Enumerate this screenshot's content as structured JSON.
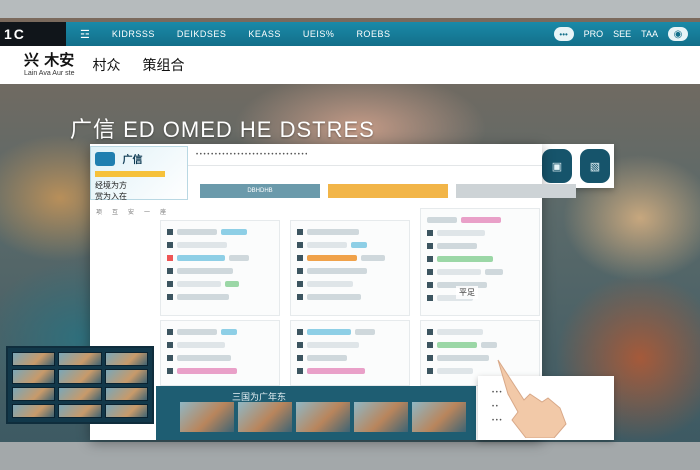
{
  "topbar": {
    "brand": "1C",
    "menu_icon": "☲",
    "links": [
      "KIDRSSS",
      "DEIKDSES",
      "KEASS",
      "UEIS%",
      "ROEBS"
    ],
    "right_links": [
      "PRO",
      "SEE",
      "TAA"
    ],
    "globe_icon": "globe-icon"
  },
  "header": {
    "logo_main": "兴 木安",
    "logo_sub": "Lain Ava Aur ste",
    "tag1": "村众",
    "tag2": "策组合"
  },
  "hero": {
    "title": "广信 ED OMED HE DSTRES"
  },
  "window": {
    "info_card": {
      "title": "广信",
      "lines": [
        "经境为方",
        "赏为入在"
      ]
    },
    "tabs": [
      "DBHDHB",
      "",
      ""
    ],
    "subnav": [
      "项",
      "互",
      "安",
      "一",
      "座"
    ],
    "float_note": "平足"
  },
  "bottom_strip": {
    "title": "三国为广年东"
  },
  "right_icons": [
    "grid-icon",
    "bag-icon",
    "backpack-icon"
  ],
  "colors": {
    "nav": "#1a8aa8",
    "tab_blue": "#6b9aab",
    "tab_orange": "#f2b548",
    "bar_blue": "#8ecfe6",
    "bar_orange": "#f0a24a",
    "bar_pink": "#e9a0c8",
    "bar_green": "#9bd7a6"
  }
}
